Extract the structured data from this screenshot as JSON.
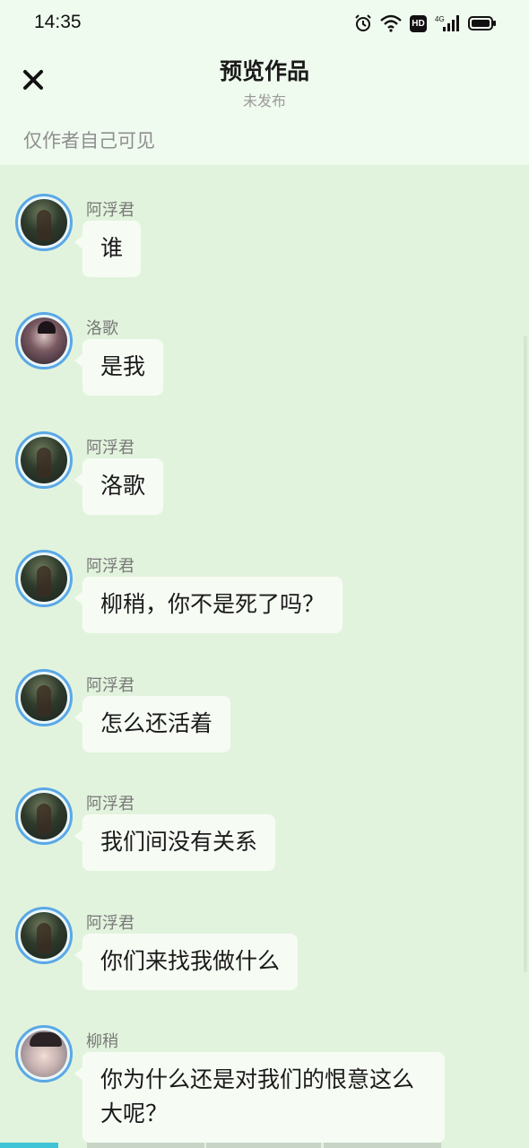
{
  "status_bar": {
    "time": "14:35",
    "icons": [
      "alarm-icon",
      "wifi-icon",
      "hd-icon",
      "4g-signal-icon",
      "battery-icon"
    ],
    "hd_label": "HD",
    "network_label": "4G"
  },
  "header": {
    "close_icon": "close-icon",
    "title": "预览作品",
    "subtitle": "未发布",
    "visibility_note": "仅作者自己可见"
  },
  "messages": [
    {
      "speaker": "阿浮君",
      "text": "谁",
      "avatar": "afujun"
    },
    {
      "speaker": "洛歌",
      "text": "是我",
      "avatar": "luoge"
    },
    {
      "speaker": "阿浮君",
      "text": "洛歌",
      "avatar": "afujun"
    },
    {
      "speaker": "阿浮君",
      "text": "柳稍，你不是死了吗？",
      "avatar": "afujun"
    },
    {
      "speaker": "阿浮君",
      "text": "怎么还活着",
      "avatar": "afujun"
    },
    {
      "speaker": "阿浮君",
      "text": "我们间没有关系",
      "avatar": "afujun"
    },
    {
      "speaker": "阿浮君",
      "text": "你们来找我做什么",
      "avatar": "afujun"
    },
    {
      "speaker": "柳稍",
      "text": "你为什么还是对我们的恨意这么大呢？",
      "avatar": "liushao"
    }
  ],
  "colors": {
    "background": "#e2f3dd",
    "header_background": "#f0fbef",
    "bubble": "#f6fcf4",
    "avatar_ring": "#5aa8e6",
    "accent": "#3fc3d6"
  }
}
